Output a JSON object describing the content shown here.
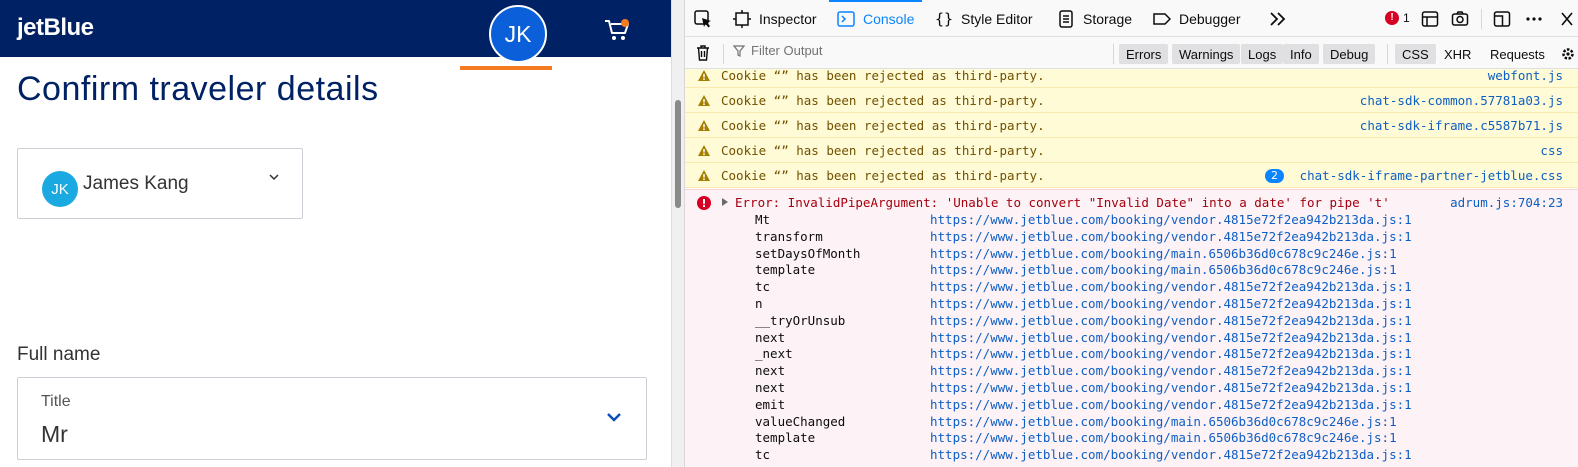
{
  "page": {
    "logo": "jetBlue",
    "user_initials": "JK",
    "title": "Confirm traveler details",
    "traveler": {
      "initials": "JK",
      "name": "James Kang"
    },
    "full_name_label": "Full name",
    "title_field": {
      "label": "Title",
      "value": "Mr"
    }
  },
  "devtools": {
    "tabs": [
      {
        "label": "Inspector",
        "icon": "inspector-icon"
      },
      {
        "label": "Console",
        "icon": "console-icon",
        "selected": true
      },
      {
        "label": "Style Editor",
        "icon": "style-editor-icon"
      },
      {
        "label": "Storage",
        "icon": "storage-icon"
      },
      {
        "label": "Debugger",
        "icon": "debugger-icon"
      }
    ],
    "error_count": "1",
    "filter_placeholder": "Filter Output",
    "filters": [
      "Errors",
      "Warnings",
      "Logs",
      "Info",
      "Debug"
    ],
    "net_filters": [
      "CSS",
      "XHR",
      "Requests"
    ],
    "warnings": [
      {
        "message": "Cookie “” has been rejected as third-party.",
        "source": "webfont.js"
      },
      {
        "message": "Cookie “” has been rejected as third-party.",
        "source": "chat-sdk-common.57781a03.js"
      },
      {
        "message": "Cookie “” has been rejected as third-party.",
        "source": "chat-sdk-iframe.c5587b71.js"
      },
      {
        "message": "Cookie “” has been rejected as third-party.",
        "source": "css"
      },
      {
        "message": "Cookie “” has been rejected as third-party.",
        "source": "chat-sdk-iframe-partner-jetblue.css",
        "count": "2"
      }
    ],
    "error": {
      "message": "Error: InvalidPipeArgument: 'Unable to convert \"Invalid Date\" into a date' for pipe 't'",
      "source": "adrum.js:704:23",
      "stack": [
        {
          "fn": "Mt",
          "loc": "https://www.jetblue.com/booking/vendor.4815e72f2ea942b213da.js:1"
        },
        {
          "fn": "transform",
          "loc": "https://www.jetblue.com/booking/vendor.4815e72f2ea942b213da.js:1"
        },
        {
          "fn": "setDaysOfMonth",
          "loc": "https://www.jetblue.com/booking/main.6506b36d0c678c9c246e.js:1"
        },
        {
          "fn": "template",
          "loc": "https://www.jetblue.com/booking/main.6506b36d0c678c9c246e.js:1"
        },
        {
          "fn": "tc",
          "loc": "https://www.jetblue.com/booking/vendor.4815e72f2ea942b213da.js:1"
        },
        {
          "fn": "n",
          "loc": "https://www.jetblue.com/booking/vendor.4815e72f2ea942b213da.js:1"
        },
        {
          "fn": "__tryOrUnsub",
          "loc": "https://www.jetblue.com/booking/vendor.4815e72f2ea942b213da.js:1"
        },
        {
          "fn": "next",
          "loc": "https://www.jetblue.com/booking/vendor.4815e72f2ea942b213da.js:1"
        },
        {
          "fn": "_next",
          "loc": "https://www.jetblue.com/booking/vendor.4815e72f2ea942b213da.js:1"
        },
        {
          "fn": "next",
          "loc": "https://www.jetblue.com/booking/vendor.4815e72f2ea942b213da.js:1"
        },
        {
          "fn": "next",
          "loc": "https://www.jetblue.com/booking/vendor.4815e72f2ea942b213da.js:1"
        },
        {
          "fn": "emit",
          "loc": "https://www.jetblue.com/booking/vendor.4815e72f2ea942b213da.js:1"
        },
        {
          "fn": "valueChanged",
          "loc": "https://www.jetblue.com/booking/main.6506b36d0c678c9c246e.js:1"
        },
        {
          "fn": "template",
          "loc": "https://www.jetblue.com/booking/main.6506b36d0c678c9c246e.js:1"
        },
        {
          "fn": "tc",
          "loc": "https://www.jetblue.com/booking/vendor.4815e72f2ea942b213da.js:1"
        }
      ]
    }
  },
  "colors": {
    "nav_bg": "#002163",
    "accent_orange": "#f47b20",
    "avatar_blue": "#0b5fd8",
    "devtools_selected": "#0a84ff"
  }
}
